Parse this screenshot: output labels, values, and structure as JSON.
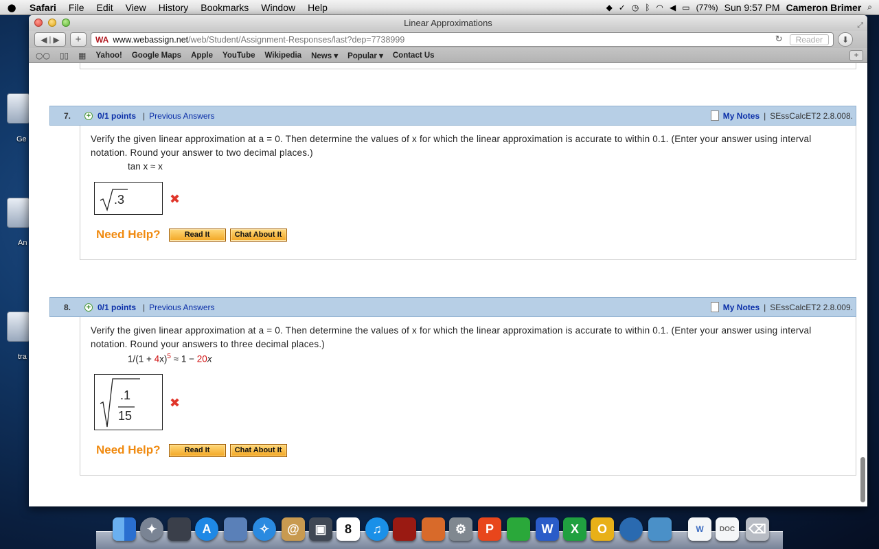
{
  "menubar": {
    "apple": "",
    "items": [
      "Safari",
      "File",
      "Edit",
      "View",
      "History",
      "Bookmarks",
      "Window",
      "Help"
    ],
    "battery": "(77%)",
    "clock": "Sun 9:57 PM",
    "user": "Cameron Brimer"
  },
  "desktop": {
    "labels": [
      "Ge",
      "An",
      "tra"
    ]
  },
  "window": {
    "title": "Linear Approximations",
    "address_host": "www.webassign.net",
    "address_path": "/web/Student/Assignment-Responses/last?dep=7738999",
    "reader_label": "Reader",
    "bookmarks": [
      "Yahoo!",
      "Google Maps",
      "Apple",
      "YouTube",
      "Wikipedia",
      "News ▾",
      "Popular ▾",
      "Contact Us"
    ]
  },
  "questions": [
    {
      "number": "7.",
      "points": "0/1 points",
      "sep": "|",
      "previous": "Previous Answers",
      "notes": "My Notes",
      "notes_sep": "|",
      "code": "SEssCalcET2 2.8.008.",
      "text": "Verify the given linear approximation at a = 0. Then determine the values of x for which the linear approximation is accurate to within 0.1. (Enter your answer using interval notation. Round your answer to two decimal places.)",
      "formula": "tan x ≈ x",
      "answer": ".3",
      "need_help": "Need Help?",
      "read_it": "Read It",
      "chat_about_it": "Chat About It"
    },
    {
      "number": "8.",
      "points": "0/1 points",
      "sep": "|",
      "previous": "Previous Answers",
      "notes": "My Notes",
      "notes_sep": "|",
      "code": "SEssCalcET2 2.8.009.",
      "text": "Verify the given linear approximation at a = 0. Then determine the values of x for which the linear approximation is accurate to within 0.1. (Enter your answer using interval notation. Round your answers to three decimal places.)",
      "formula_parts": [
        "1/(1 + ",
        "4",
        "x)",
        "5",
        " ≈ 1 − ",
        "20",
        "x"
      ],
      "answer_num": ".1",
      "answer_den": "15",
      "need_help": "Need Help?",
      "read_it": "Read It",
      "chat_about_it": "Chat About It"
    }
  ],
  "dock": {
    "apps": [
      "Finder",
      "Launchpad",
      "Photo Booth",
      "App Store",
      "Preview",
      "Safari",
      "Contacts",
      "FaceTime",
      "Calendar",
      "iTunes",
      "Photo Slideshow",
      "iPhoto",
      "System Preferences",
      "PowerPoint",
      "Messenger",
      "Word",
      "Excel",
      "Outlook",
      "Network",
      "Remote Desktop",
      "Document",
      "Document",
      "Trash"
    ],
    "calendar_day": "8"
  }
}
